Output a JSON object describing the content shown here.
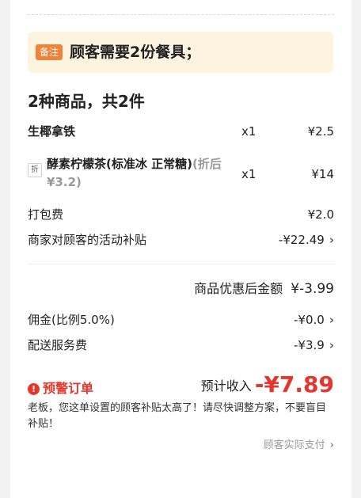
{
  "note": {
    "tag": "备注",
    "text": "顾客需要2份餐具；"
  },
  "summary": "2种商品，共2件",
  "items": [
    {
      "name": "生椰拿铁",
      "qty": "x1",
      "price": "¥2.5"
    },
    {
      "tag": "折",
      "name": "酵素柠檬茶(标准冰 正常糖)",
      "sub_open": "(折后",
      "sub_price": "¥3.2)",
      "qty": "x1",
      "price": "¥14"
    }
  ],
  "fees": {
    "packing_label": "打包费",
    "packing_value": "¥2.0",
    "subsidy_label": "商家对顾客的活动补贴",
    "subsidy_value": "-¥22.49"
  },
  "after_discount": {
    "label": "商品优惠后金额",
    "value": "¥-3.99"
  },
  "commission": {
    "label": "佣金(比例5.0%)",
    "value": "-¥0.0"
  },
  "delivery": {
    "label": "配送服务费",
    "value": "-¥3.9"
  },
  "warning": {
    "icon": "exclamation-icon",
    "label": "预警订单"
  },
  "income": {
    "label": "预计收入",
    "value": "-¥7.89"
  },
  "advice": "老板，您这单设置的顾客补贴太高了！请尽快调整方案，不要盲目补贴！",
  "actual_pay": "顾客实际支付",
  "colors": {
    "warning_red": "#e5362c",
    "note_bg": "#fdf4e0",
    "note_tag": "#f0823a"
  }
}
